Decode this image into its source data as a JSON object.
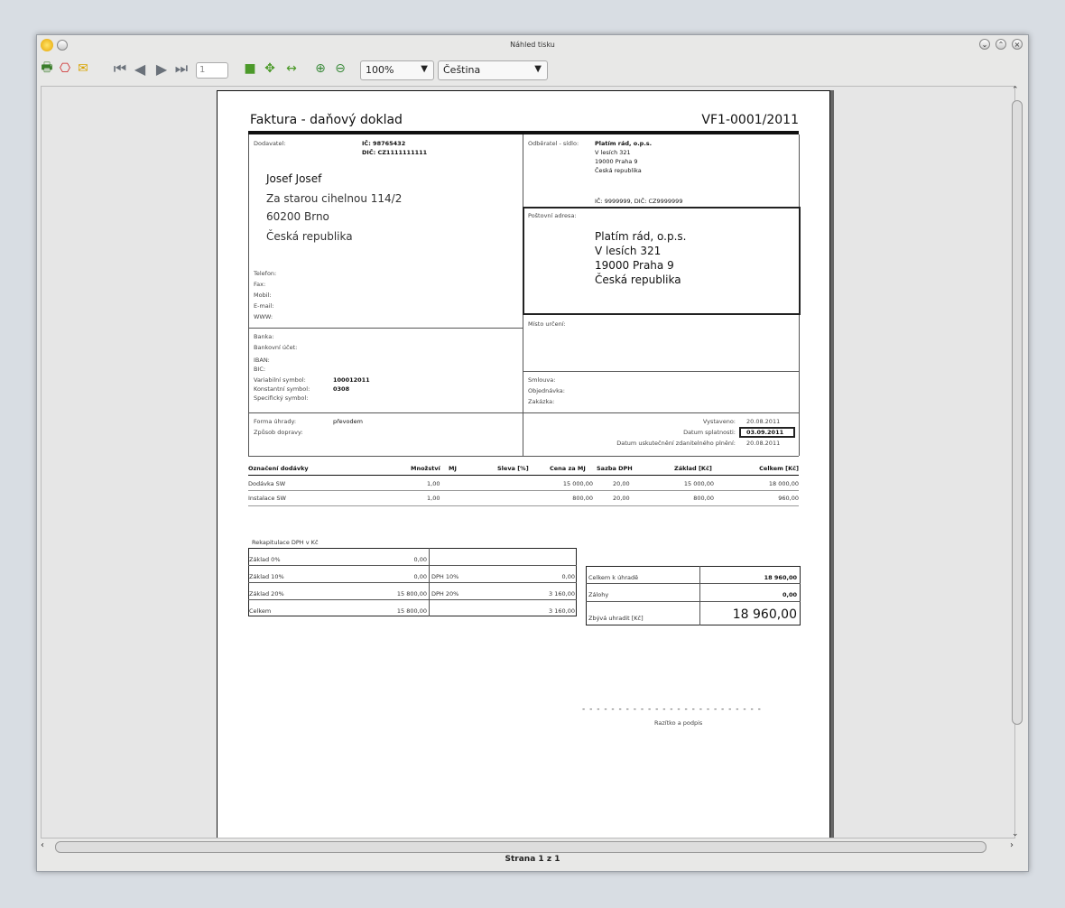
{
  "window": {
    "title": "Náhled tisku"
  },
  "toolbar": {
    "page_number": "1",
    "zoom": "100%",
    "language": "Čeština"
  },
  "status": {
    "page_indicator": "Strana 1 z 1"
  },
  "invoice": {
    "heading": "Faktura - daňový doklad",
    "number": "VF1-0001/2011",
    "supplier": {
      "label": "Dodavatel:",
      "ic": "IČ: 98765432",
      "dic": "DIČ: CZ1111111111",
      "name": "Josef Josef",
      "street": "Za starou cihelnou 114/2",
      "city": "60200  Brno",
      "country": "Česká republika",
      "contact_labels": [
        "Telefon:",
        "Fax:",
        "Mobil:",
        "E-mail:",
        "WWW:"
      ]
    },
    "buyer": {
      "label": "Odběratel - sídlo:",
      "lines": [
        "Platím rád, o.p.s.",
        "V lesích 321",
        "19000  Praha 9",
        "Česká republika"
      ],
      "ids": "IČ: 9999999, DIČ: CZ9999999",
      "postal_label": "Poštovní adresa:",
      "postal_lines": [
        "Platím rád, o.p.s.",
        "V lesích 321",
        "19000 Praha 9",
        "Česká republika"
      ],
      "destination_label": "Místo určení:"
    },
    "bank": {
      "labels": [
        "Banka:",
        "Bankovní účet:",
        "IBAN:",
        "BIC:"
      ],
      "var_label": "Variabilní symbol:",
      "var_value": "100012011",
      "const_label": "Konstantní symbol:",
      "const_value": "0308",
      "spec_label": "Specifický symbol:"
    },
    "contract_labels": [
      "Smlouva:",
      "Objednávka:",
      "Zakázka:"
    ],
    "payment": {
      "form_label": "Forma úhrady:",
      "form_value": "převodem",
      "transport_label": "Způsob dopravy:"
    },
    "dates": {
      "issued_label": "Vystaveno:",
      "issued": "20.08.2011",
      "due_label": "Datum splatnosti:",
      "due": "03.09.2011",
      "taxable_label": "Datum uskutečnění zdanitelného plnění:",
      "taxable": "20.08.2011"
    },
    "items_headers": [
      "Označení dodávky",
      "Množství",
      "MJ",
      "Sleva [%]",
      "Cena za MJ",
      "Sazba DPH",
      "Základ [Kč]",
      "Celkem [Kč]"
    ],
    "items": [
      {
        "name": "Dodávka SW",
        "qty": "1,00",
        "price": "15 000,00",
        "rate": "20,00",
        "base": "15 000,00",
        "total": "18 000,00"
      },
      {
        "name": "Instalace SW",
        "qty": "1,00",
        "price": "800,00",
        "rate": "20,00",
        "base": "800,00",
        "total": "960,00"
      }
    ],
    "vat_recap": {
      "title": "Rekapitulace DPH v Kč",
      "rows": [
        {
          "label": "Základ 0%",
          "base": "0,00",
          "vat_label": "",
          "vat": ""
        },
        {
          "label": "Základ 10%",
          "base": "0,00",
          "vat_label": "DPH 10%",
          "vat": "0,00"
        },
        {
          "label": "Základ 20%",
          "base": "15 800,00",
          "vat_label": "DPH 20%",
          "vat": "3 160,00"
        },
        {
          "label": "Celkem",
          "base": "15 800,00",
          "vat_label": "",
          "vat": "3 160,00"
        }
      ]
    },
    "totals": {
      "to_pay_label": "Celkem k úhradě",
      "to_pay": "18 960,00",
      "advances_label": "Zálohy",
      "advances": "0,00",
      "remaining_label": "Zbývá uhradit [Kč]",
      "remaining": "18 960,00"
    },
    "signature": {
      "dashes": "- - - - - - - - - - - - - - - - - - - - - - - - -",
      "label": "Razítko a podpis"
    }
  }
}
